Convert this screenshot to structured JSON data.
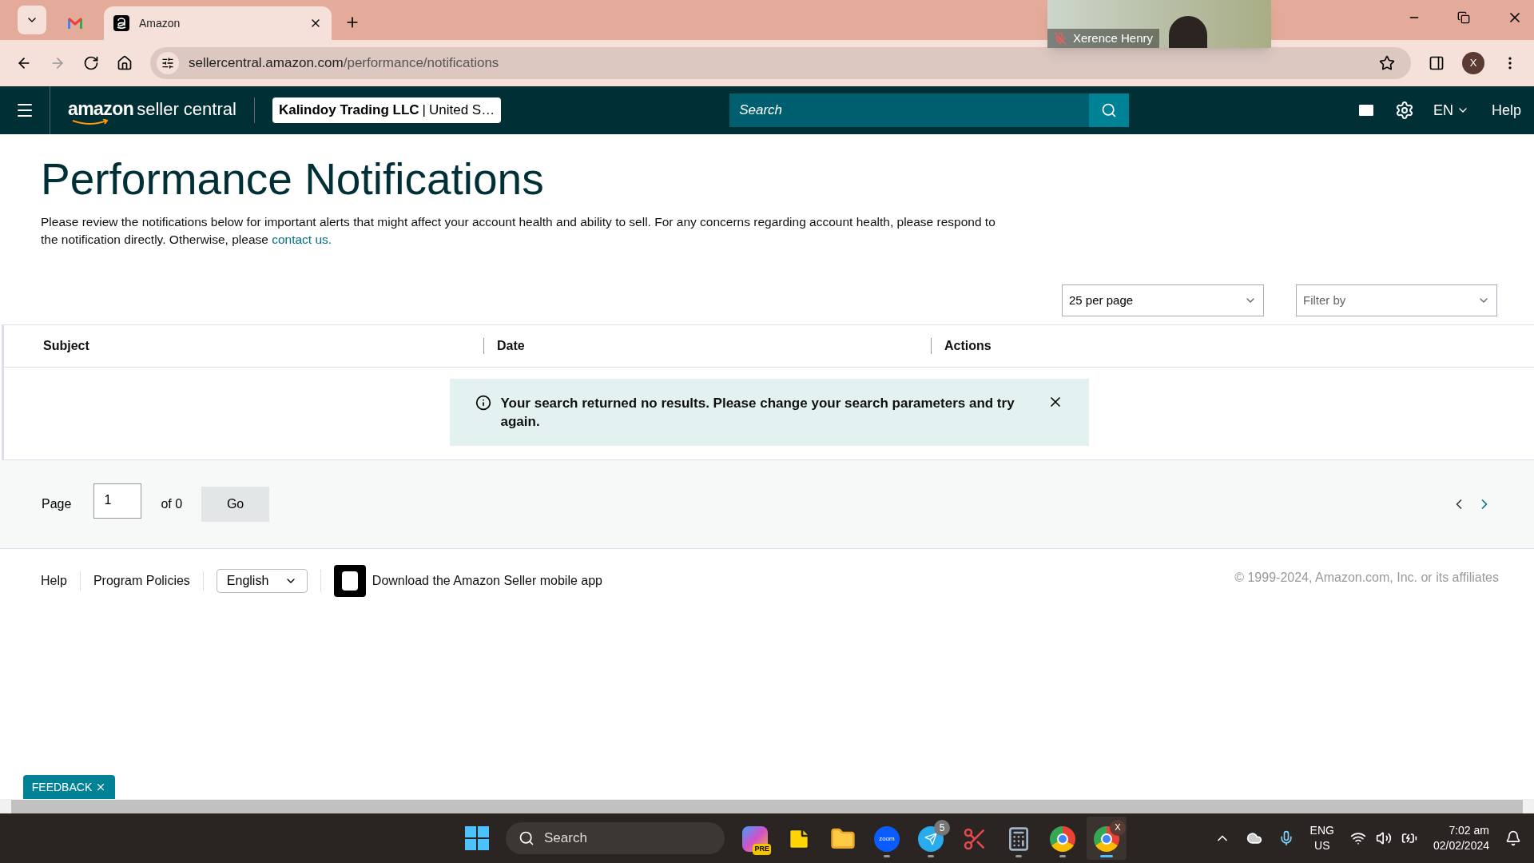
{
  "browser": {
    "tabs": [
      {
        "kind": "gmail",
        "selected": false
      },
      {
        "kind": "amazon",
        "title": "Amazon",
        "selected": true
      }
    ],
    "url": {
      "host": "sellercentral.amazon.com",
      "path": "/performance/notifications"
    },
    "profile_initial": "X"
  },
  "video_overlay": {
    "name": "Xerence Henry",
    "muted": true
  },
  "header": {
    "logo_brand": "amazon",
    "logo_product": "seller central",
    "account": {
      "name": "Kalindoy Trading LLC",
      "separator": "|",
      "region": "United S…"
    },
    "search": {
      "placeholder": "Search"
    },
    "language": "EN",
    "help": "Help"
  },
  "page": {
    "title": "Performance Notifications",
    "intro": "Please review the notifications below for important alerts that might affect your account health and ability to sell. For any concerns regarding account health, please respond to the notification directly. Otherwise, please ",
    "intro_link": "contact us.",
    "per_page": "25 per page",
    "filter": {
      "placeholder": "Filter by"
    }
  },
  "table": {
    "columns": [
      "Subject",
      "Date",
      "Actions"
    ],
    "alert": {
      "kind": "info",
      "text": "Your search returned no results. Please change your search parameters and try again."
    }
  },
  "pager": {
    "label": "Page",
    "value": "1",
    "of": "of 0",
    "go": "Go"
  },
  "footer": {
    "links": [
      "Help",
      "Program Policies"
    ],
    "language": "English",
    "app": "Download the Amazon Seller mobile app",
    "copyright": "© 1999-2024, Amazon.com, Inc. or its affiliates"
  },
  "feedback": "FEEDBACK",
  "taskbar": {
    "search": {
      "placeholder": "Search"
    },
    "apps": [
      {
        "kind": "copilot",
        "badge": "PRE",
        "running": false,
        "active": false
      },
      {
        "kind": "notes",
        "running": false,
        "active": false
      },
      {
        "kind": "folder",
        "running": false,
        "active": false
      },
      {
        "kind": "zoom",
        "badge": "zoom",
        "running": true,
        "active": false
      },
      {
        "kind": "telegram",
        "badge": "5",
        "running": true,
        "active": false
      },
      {
        "kind": "snip",
        "running": false,
        "active": false
      },
      {
        "kind": "calculator",
        "running": true,
        "active": false
      },
      {
        "kind": "chrome",
        "running": true,
        "active": false
      },
      {
        "kind": "chrome",
        "badge": "X",
        "running": true,
        "active": true
      }
    ],
    "lang": [
      "ENG",
      "US"
    ],
    "time": "7:02 am",
    "date": "02/02/2024"
  }
}
